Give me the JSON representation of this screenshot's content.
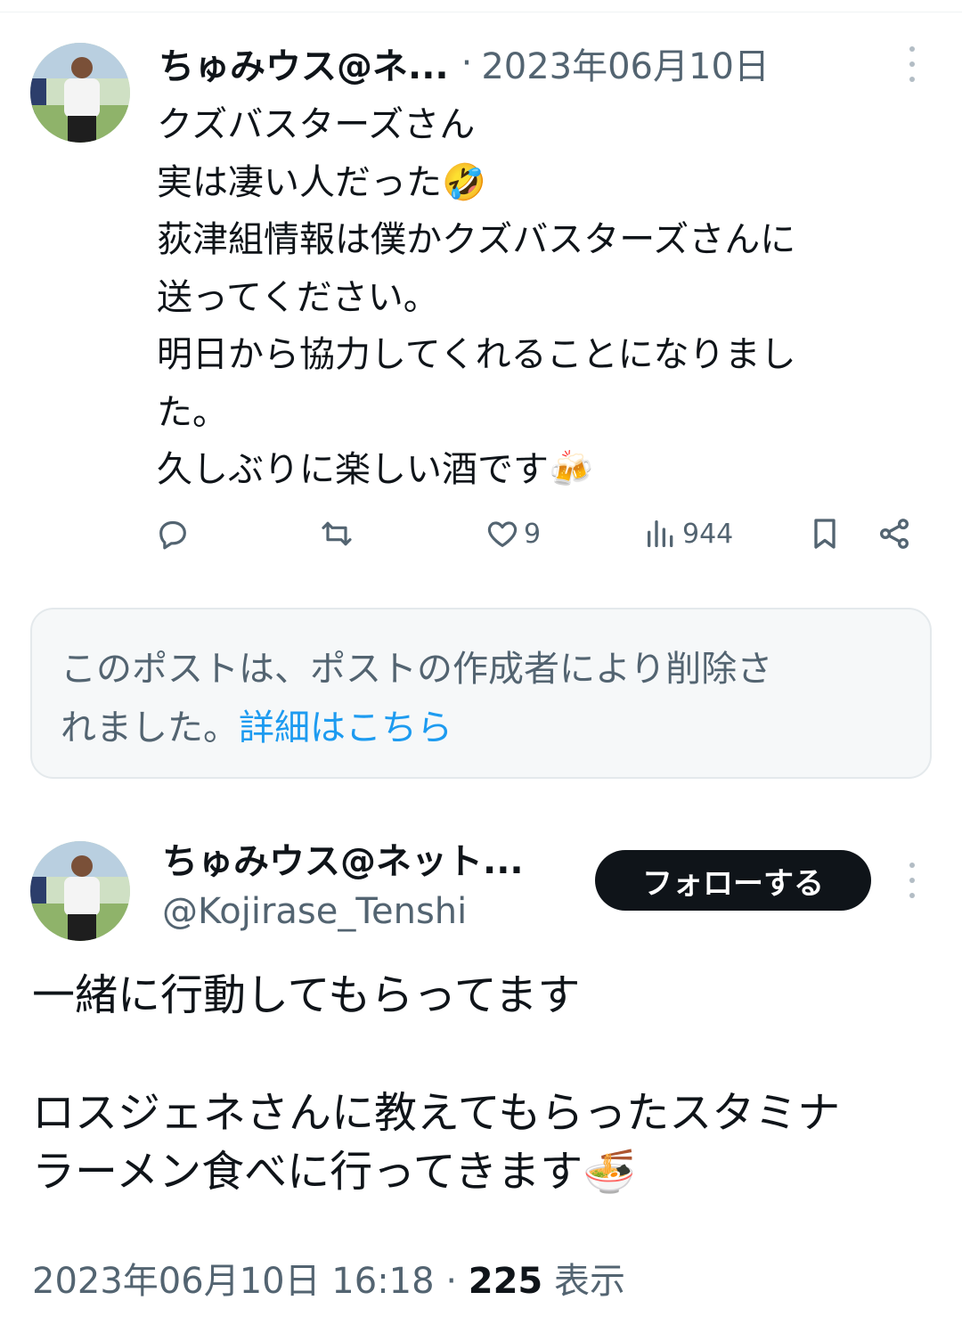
{
  "tweet1": {
    "author_name": "ちゅみウス@ネ...",
    "separator": "·",
    "date": "2023年06月10日",
    "lines": [
      "クズバスターズさん",
      "実は凄い人だった🤣",
      "荻津組情報は僕かクズバスターズさんに",
      "送ってください。",
      "明日から協力してくれることになりまし",
      "た。",
      "久しぶりに楽しい酒です🍻"
    ],
    "actions": {
      "reply_icon": "reply-icon",
      "retweet_icon": "retweet-icon",
      "like_icon": "heart-icon",
      "like_count": "9",
      "views_icon": "bar-chart-icon",
      "views_count": "944",
      "bookmark_icon": "bookmark-icon",
      "share_icon": "share-icon"
    }
  },
  "deleted_notice": {
    "line1": "このポストは、ポストの作成者により削除さ",
    "line2_text": "れました。",
    "link_text": "詳細はこちら",
    "link_color": "#1d9bf0"
  },
  "tweet2": {
    "author_name": "ちゅみウス@ネット...",
    "handle": "@Kojirase_Tenshi",
    "follow_label": "フォローする",
    "lines": [
      "一緒に行動してもらってます",
      "",
      "ロスジェネさんに教えてもらったスタミナ",
      "ラーメン食べに行ってきます🍜"
    ],
    "timestamp": "2023年06月10日 16:18",
    "separator": "·",
    "views_count": "225",
    "views_label": "表示"
  },
  "colors": {
    "text_primary": "#0f1419",
    "text_secondary": "#536471",
    "link": "#1d9bf0",
    "button_bg": "#0f1419"
  }
}
